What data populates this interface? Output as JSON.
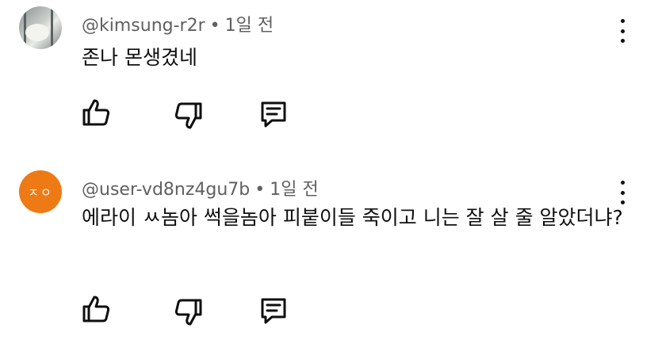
{
  "comments": [
    {
      "handle": "@kimsung-r2r",
      "separator": "•",
      "time": "1일 전",
      "text": "존나 몬생겼네",
      "avatar": {
        "type": "photo"
      },
      "icons": {
        "like": "thumb-up-icon",
        "dislike": "thumb-down-icon",
        "reply": "reply-icon",
        "more": "more-vertical-icon"
      }
    },
    {
      "handle": "@user-vd8nz4gu7b",
      "separator": "•",
      "time": "1일 전",
      "text": "에라이 ㅆ놈아 썩을놈아 피붙이들 죽이고 니는 잘 살 줄 알았더냐?",
      "avatar": {
        "type": "initials",
        "initials": "ㅈㅇ",
        "color": "#ee7a16"
      },
      "icons": {
        "like": "thumb-up-icon",
        "dislike": "thumb-down-icon",
        "reply": "reply-icon",
        "more": "more-vertical-icon"
      }
    }
  ],
  "colors": {
    "meta": "#606060",
    "text": "#0f0f0f",
    "background": "#ffffff"
  }
}
